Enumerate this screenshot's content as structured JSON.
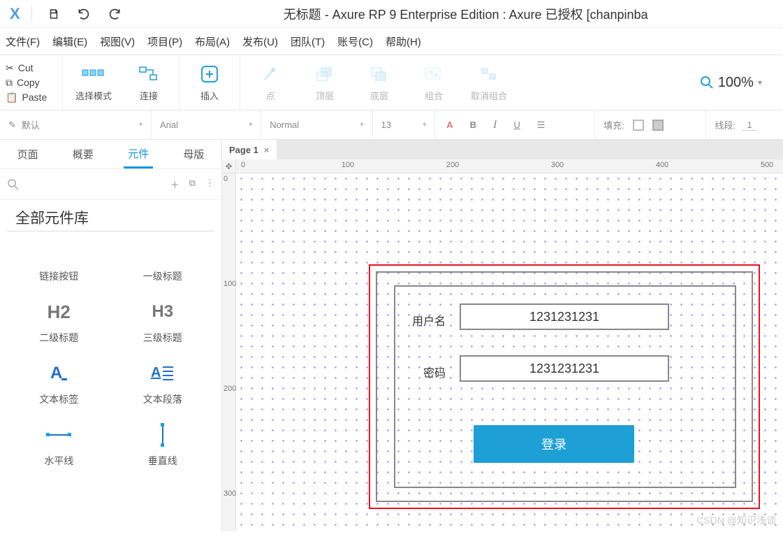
{
  "titlebar": {
    "title": "无标题 - Axure RP 9 Enterprise Edition : Axure 已授权     [chanpinba"
  },
  "menu": {
    "file": "文件(F)",
    "edit": "编辑(E)",
    "view": "视图(V)",
    "project": "项目(P)",
    "arrange": "布局(A)",
    "publish": "发布(U)",
    "team": "团队(T)",
    "account": "账号(C)",
    "help": "帮助(H)"
  },
  "clipboard": {
    "cut": "Cut",
    "copy": "Copy",
    "paste": "Paste"
  },
  "toolbar": {
    "select_mode": "选择模式",
    "connect": "连接",
    "insert": "插入",
    "point": "点",
    "top": "顶层",
    "bottom": "底层",
    "group": "组合",
    "ungroup": "取消组合"
  },
  "zoom": {
    "value": "100%"
  },
  "formatbar": {
    "style": "默认",
    "font": "Arial",
    "weight": "Normal",
    "size": "13",
    "fill_label": "填充:",
    "line_label": "线段:",
    "line_val": "1"
  },
  "sidepanel": {
    "tabs": {
      "pages": "页面",
      "outline": "概要",
      "widgets": "元件",
      "masters": "母版"
    },
    "lib_header": "全部元件库",
    "items": [
      {
        "label": "链接按钮"
      },
      {
        "label": "一级标题"
      },
      {
        "label": "二级标题"
      },
      {
        "label": "三级标题"
      },
      {
        "label": "文本标签"
      },
      {
        "label": "文本段落"
      },
      {
        "label": "水平线"
      },
      {
        "label": "垂直线"
      }
    ]
  },
  "pagetab": {
    "name": "Page 1"
  },
  "ruler": {
    "h": [
      "0",
      "100",
      "200",
      "300",
      "400",
      "500"
    ],
    "v": [
      "0",
      "100",
      "200",
      "300"
    ]
  },
  "canvas_form": {
    "user_label": "用户名",
    "user_value": "1231231231",
    "pass_label": "密码",
    "pass_value": "1231231231",
    "login": "登录"
  },
  "watermark": "CSDN @知识浅谈"
}
